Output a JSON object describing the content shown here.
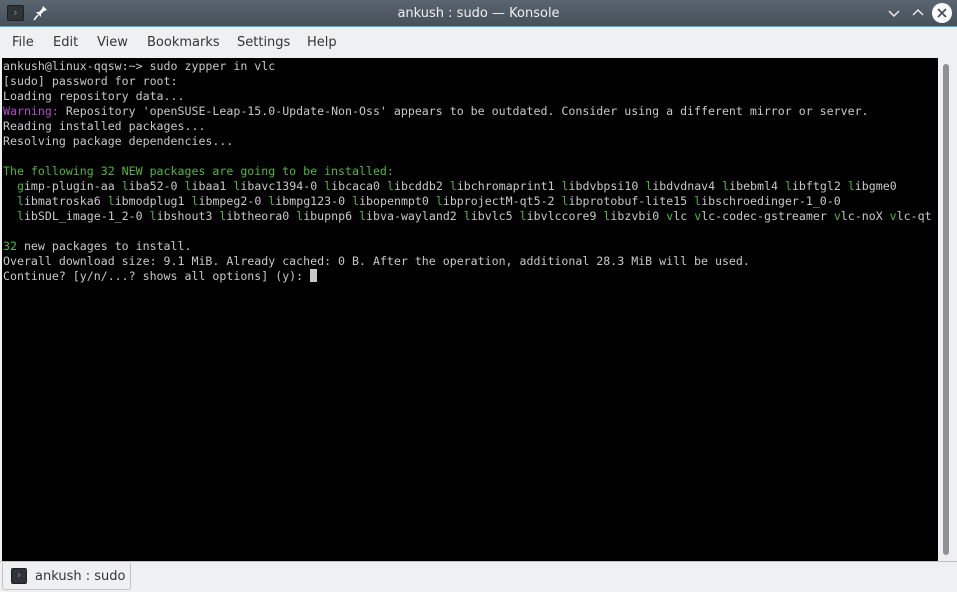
{
  "window": {
    "title": "ankush : sudo — Konsole",
    "app_icon": "terminal-icon",
    "pin_icon": "pin-icon",
    "buttons": {
      "minimize": "chevron-down-icon",
      "maximize": "chevron-up-icon",
      "close": "close-icon"
    }
  },
  "menubar": {
    "items": [
      {
        "label": "File"
      },
      {
        "label": "Edit"
      },
      {
        "label": "View"
      },
      {
        "label": "Bookmarks"
      },
      {
        "label": "Settings"
      },
      {
        "label": "Help"
      }
    ]
  },
  "colors": {
    "terminal_bg": "#000000",
    "terminal_fg": "#c8c8c8",
    "green": "#4fb83c",
    "purple": "#b04fc8",
    "accent": "#3daee9"
  },
  "terminal": {
    "lines": [
      [
        {
          "t": "ankush@linux-qqsw:~> sudo zypper in vlc"
        }
      ],
      [
        {
          "t": "[sudo] password for root:"
        }
      ],
      [
        {
          "t": "Loading repository data..."
        }
      ],
      [
        {
          "t": "Warning:",
          "c": "purple"
        },
        {
          "t": " Repository 'openSUSE-Leap-15.0-Update-Non-Oss' appears to be outdated. Consider using a different mirror or server."
        }
      ],
      [
        {
          "t": "Reading installed packages..."
        }
      ],
      [
        {
          "t": "Resolving package dependencies..."
        }
      ],
      [
        {
          "t": ""
        }
      ],
      [
        {
          "t": "The following 32 NEW packages are going to be installed:",
          "c": "green"
        }
      ],
      [
        {
          "t": "  "
        },
        {
          "pkgs": [
            "gimp-plugin-aa",
            "liba52-0",
            "libaa1",
            "libavc1394-0",
            "libcaca0",
            "libcddb2",
            "libchromaprint1",
            "libdvbpsi10",
            "libdvdnav4",
            "libebml4",
            "libftgl2",
            "libgme0"
          ]
        }
      ],
      [
        {
          "t": "  "
        },
        {
          "pkgs": [
            "libmatroska6",
            "libmodplug1",
            "libmpeg2-0",
            "libmpg123-0",
            "libopenmpt0",
            "libprojectM-qt5-2",
            "libprotobuf-lite15",
            "libschroedinger-1_0-0"
          ]
        }
      ],
      [
        {
          "t": "  "
        },
        {
          "pkgs": [
            "libSDL_image-1_2-0",
            "libshout3",
            "libtheora0",
            "libupnp6",
            "libva-wayland2",
            "libvlc5",
            "libvlccore9",
            "libzvbi0",
            "vlc",
            "vlc-codec-gstreamer",
            "vlc-noX",
            "vlc-qt"
          ]
        }
      ],
      [
        {
          "t": ""
        }
      ],
      [
        {
          "t": "32",
          "c": "green"
        },
        {
          "t": " new packages to install."
        }
      ],
      [
        {
          "t": "Overall download size: 9.1 MiB. Already cached: 0 B. After the operation, additional 28.3 MiB will be used."
        }
      ],
      [
        {
          "t": "Continue? [y/n/...? shows all options] (y): "
        },
        {
          "cursor": true
        }
      ]
    ]
  },
  "tabs": [
    {
      "label": "ankush : sudo",
      "icon": "terminal-icon"
    }
  ]
}
